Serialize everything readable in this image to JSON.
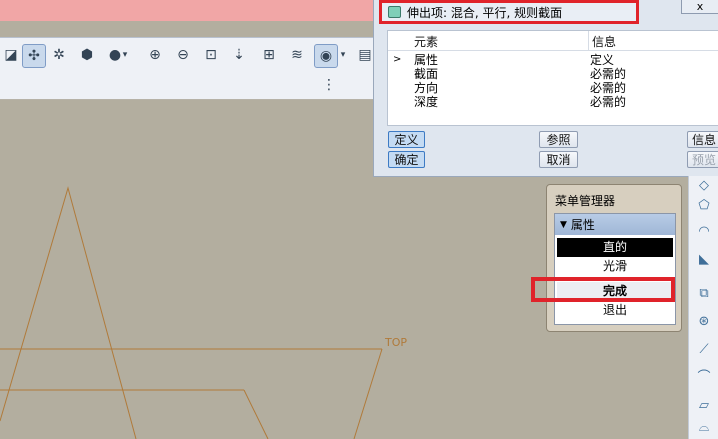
{
  "dialog": {
    "title": "伸出项: 混合, 平行, 规则截面",
    "close_label": "x",
    "columns": [
      "元素",
      "信息"
    ],
    "rows": [
      {
        "element": "属性",
        "info": "定义",
        "current": true
      },
      {
        "element": "截面",
        "info": "必需的"
      },
      {
        "element": "方向",
        "info": "必需的"
      },
      {
        "element": "深度",
        "info": "必需的"
      }
    ],
    "buttons": {
      "define": "定义",
      "reference": "参照",
      "info": "信息",
      "ok": "确定",
      "cancel": "取消",
      "preview": "预览"
    }
  },
  "menu_manager": {
    "title": "菜单管理器",
    "section": "属性",
    "items": [
      "直的",
      "光滑",
      "完成",
      "退出"
    ]
  },
  "canvas": {
    "datum_label": "TOP"
  },
  "colors": {
    "highlight_red": "#e0232a",
    "sketch_line": "#b07a3a",
    "canvas_bg": "#b3ae9f"
  }
}
